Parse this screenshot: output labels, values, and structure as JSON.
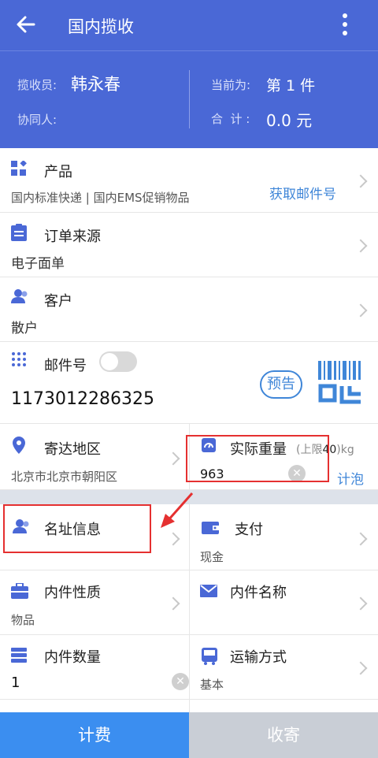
{
  "header": {
    "title": "国内揽收"
  },
  "summary": {
    "collector_label": "揽收员:",
    "collector_name": "韩永春",
    "helper_label": "协同人:",
    "current_label": "当前为:",
    "current_value": "第 1 件",
    "total_label": "合  计 :",
    "total_value": "0.0 元"
  },
  "product": {
    "label": "产品",
    "value": "国内标准快递 | 国内EMS促销物品",
    "action": "获取邮件号"
  },
  "order_source": {
    "label": "订单来源",
    "value": "电子面单"
  },
  "customer": {
    "label": "客户",
    "value": "散户"
  },
  "mail_no": {
    "label": "邮件号",
    "value": "1173012286325",
    "notice_button": "预告"
  },
  "destination": {
    "label": "寄达地区",
    "value": "北京市北京市朝阳区"
  },
  "weight": {
    "label": "实际重量",
    "limit_prefix": "(上限",
    "limit_value": "40",
    "limit_suffix": ")kg",
    "value": "963",
    "action": "计泡"
  },
  "address_info": {
    "label": "名址信息"
  },
  "payment": {
    "label": "支付",
    "value": "现金"
  },
  "content_nature": {
    "label": "内件性质",
    "value": "物品"
  },
  "content_name": {
    "label": "内件名称"
  },
  "content_qty": {
    "label": "内件数量",
    "value": "1"
  },
  "transport": {
    "label": "运输方式",
    "value": "基本"
  },
  "footer": {
    "charge_label": "计费",
    "submit_label": "收寄"
  },
  "colors": {
    "primary": "#4a68d6",
    "link": "#3f86d8",
    "charge_button": "#3b8ef0",
    "submit_button": "#c9ced6",
    "highlight": "#e53030"
  }
}
